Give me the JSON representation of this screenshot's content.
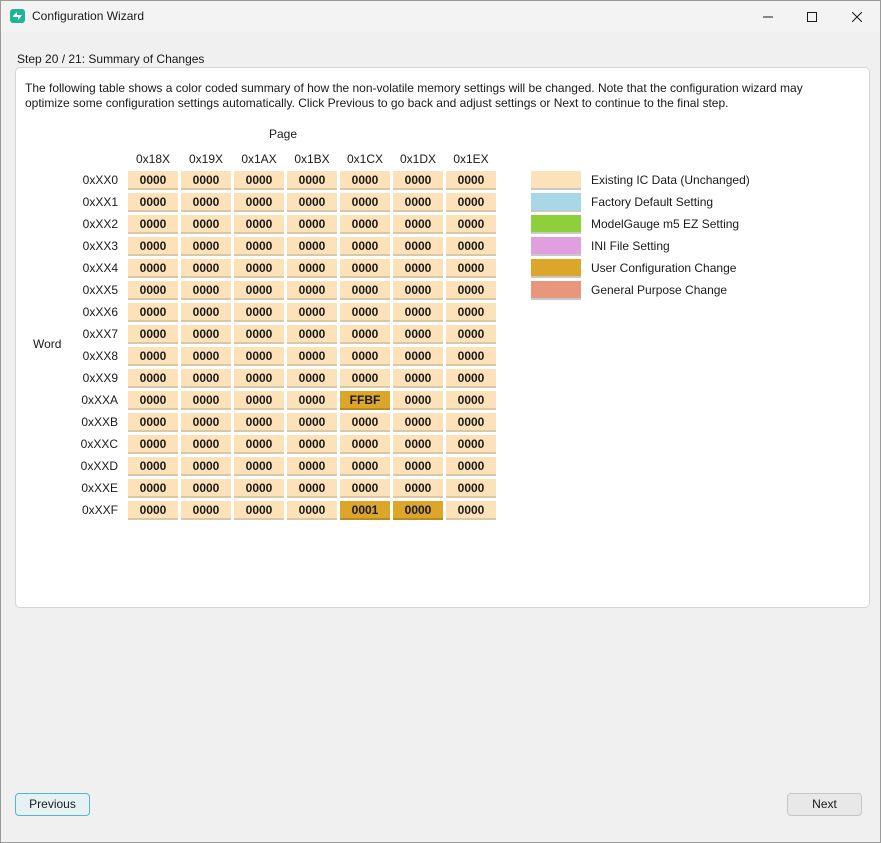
{
  "window": {
    "title": "Configuration Wizard",
    "controls": {
      "minimize": "minimize-icon",
      "maximize": "maximize-icon",
      "close": "close-icon"
    }
  },
  "step_title": "Step 20 / 21: Summary of Changes",
  "description": "The following table shows a color coded summary of how the non-volatile memory settings will be changed. Note that the configuration wizard may optimize some configuration settings automatically. Click Previous to go back and adjust settings or Next to continue to the final step.",
  "table": {
    "page_label": "Page",
    "word_label": "Word",
    "columns": [
      "0x18X",
      "0x19X",
      "0x1AX",
      "0x1BX",
      "0x1CX",
      "0x1DX",
      "0x1EX"
    ],
    "rows": [
      "0xXX0",
      "0xXX1",
      "0xXX2",
      "0xXX3",
      "0xXX4",
      "0xXX5",
      "0xXX6",
      "0xXX7",
      "0xXX8",
      "0xXX9",
      "0xXXA",
      "0xXXB",
      "0xXXC",
      "0xXXD",
      "0xXXE",
      "0xXXF"
    ],
    "values": [
      [
        "0000",
        "0000",
        "0000",
        "0000",
        "0000",
        "0000",
        "0000"
      ],
      [
        "0000",
        "0000",
        "0000",
        "0000",
        "0000",
        "0000",
        "0000"
      ],
      [
        "0000",
        "0000",
        "0000",
        "0000",
        "0000",
        "0000",
        "0000"
      ],
      [
        "0000",
        "0000",
        "0000",
        "0000",
        "0000",
        "0000",
        "0000"
      ],
      [
        "0000",
        "0000",
        "0000",
        "0000",
        "0000",
        "0000",
        "0000"
      ],
      [
        "0000",
        "0000",
        "0000",
        "0000",
        "0000",
        "0000",
        "0000"
      ],
      [
        "0000",
        "0000",
        "0000",
        "0000",
        "0000",
        "0000",
        "0000"
      ],
      [
        "0000",
        "0000",
        "0000",
        "0000",
        "0000",
        "0000",
        "0000"
      ],
      [
        "0000",
        "0000",
        "0000",
        "0000",
        "0000",
        "0000",
        "0000"
      ],
      [
        "0000",
        "0000",
        "0000",
        "0000",
        "0000",
        "0000",
        "0000"
      ],
      [
        "0000",
        "0000",
        "0000",
        "0000",
        "FFBF",
        "0000",
        "0000"
      ],
      [
        "0000",
        "0000",
        "0000",
        "0000",
        "0000",
        "0000",
        "0000"
      ],
      [
        "0000",
        "0000",
        "0000",
        "0000",
        "0000",
        "0000",
        "0000"
      ],
      [
        "0000",
        "0000",
        "0000",
        "0000",
        "0000",
        "0000",
        "0000"
      ],
      [
        "0000",
        "0000",
        "0000",
        "0000",
        "0000",
        "0000",
        "0000"
      ],
      [
        "0000",
        "0000",
        "0000",
        "0000",
        "0001",
        "0000",
        "0000"
      ]
    ],
    "cell_categories": [
      [
        "existing",
        "existing",
        "existing",
        "existing",
        "existing",
        "existing",
        "existing"
      ],
      [
        "existing",
        "existing",
        "existing",
        "existing",
        "existing",
        "existing",
        "existing"
      ],
      [
        "existing",
        "existing",
        "existing",
        "existing",
        "existing",
        "existing",
        "existing"
      ],
      [
        "existing",
        "existing",
        "existing",
        "existing",
        "existing",
        "existing",
        "existing"
      ],
      [
        "existing",
        "existing",
        "existing",
        "existing",
        "existing",
        "existing",
        "existing"
      ],
      [
        "existing",
        "existing",
        "existing",
        "existing",
        "existing",
        "existing",
        "existing"
      ],
      [
        "existing",
        "existing",
        "existing",
        "existing",
        "existing",
        "existing",
        "existing"
      ],
      [
        "existing",
        "existing",
        "existing",
        "existing",
        "existing",
        "existing",
        "existing"
      ],
      [
        "existing",
        "existing",
        "existing",
        "existing",
        "existing",
        "existing",
        "existing"
      ],
      [
        "existing",
        "existing",
        "existing",
        "existing",
        "existing",
        "existing",
        "existing"
      ],
      [
        "existing",
        "existing",
        "existing",
        "existing",
        "user",
        "existing",
        "existing"
      ],
      [
        "existing",
        "existing",
        "existing",
        "existing",
        "existing",
        "existing",
        "existing"
      ],
      [
        "existing",
        "existing",
        "existing",
        "existing",
        "existing",
        "existing",
        "existing"
      ],
      [
        "existing",
        "existing",
        "existing",
        "existing",
        "existing",
        "existing",
        "existing"
      ],
      [
        "existing",
        "existing",
        "existing",
        "existing",
        "existing",
        "existing",
        "existing"
      ],
      [
        "existing",
        "existing",
        "existing",
        "existing",
        "user",
        "user",
        "existing"
      ]
    ]
  },
  "legend": [
    {
      "key": "existing",
      "label": "Existing IC Data (Unchanged)",
      "color": "#fde1b8"
    },
    {
      "key": "factory",
      "label": "Factory Default Setting",
      "color": "#a8d8e8"
    },
    {
      "key": "modelgauge",
      "label": "ModelGauge m5 EZ Setting",
      "color": "#8fcf3a"
    },
    {
      "key": "ini",
      "label": "INI File Setting",
      "color": "#e0a0e0"
    },
    {
      "key": "user",
      "label": "User Configuration Change",
      "color": "#dba62a"
    },
    {
      "key": "general",
      "label": "General Purpose Change",
      "color": "#e9977a"
    }
  ],
  "buttons": {
    "previous": "Previous",
    "next": "Next"
  }
}
